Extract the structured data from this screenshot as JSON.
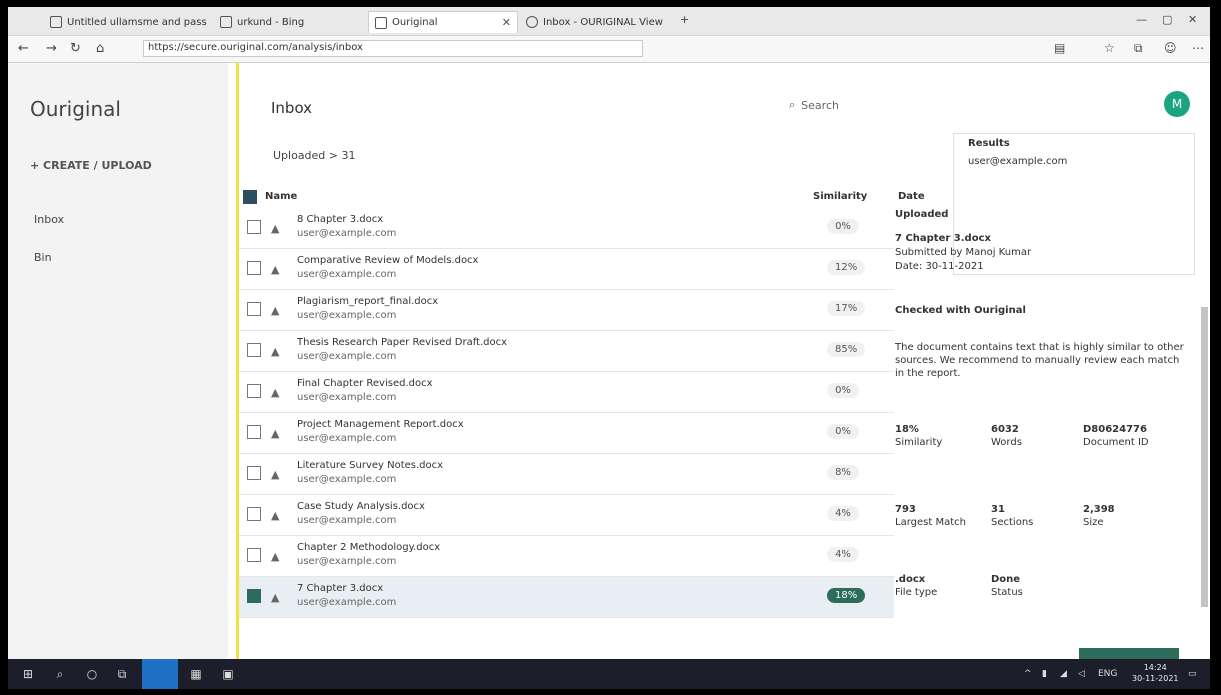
{
  "browser": {
    "tabs": [
      {
        "label": "Untitled ullamsme and pass"
      },
      {
        "label": "urkund - Bing"
      },
      {
        "label": "Ouriginal",
        "active": true
      },
      {
        "label": "Inbox - OURIGINAL View"
      }
    ],
    "new_tab": "+",
    "address": "https://secure.ouriginal.com/analysis/inbox",
    "window_controls": [
      "—",
      "▢",
      "✕"
    ]
  },
  "app": {
    "logo": "Ouriginal",
    "create_button": "+ CREATE / UPLOAD",
    "sidebar_links": [
      "Inbox",
      "Bin"
    ],
    "inbox_title": "Inbox",
    "folder": "Uploaded > 31",
    "search_placeholder": "Search",
    "avatar_letter": "M"
  },
  "list": {
    "header": {
      "name": "Name",
      "similarity": "Similarity",
      "date": "Date"
    },
    "rows": [
      {
        "file": "8 Chapter 3.docx",
        "email": "user@example.com",
        "pct": "0%"
      },
      {
        "file": "Comparative Review of Models.docx",
        "email": "user@example.com",
        "pct": "12%"
      },
      {
        "file": "Plagiarism_report_final.docx",
        "email": "user@example.com",
        "pct": "17%"
      },
      {
        "file": "Thesis Research Paper Revised Draft.docx",
        "email": "user@example.com",
        "pct": "85%"
      },
      {
        "file": "Final Chapter Revised.docx",
        "email": "user@example.com",
        "pct": "0%"
      },
      {
        "file": "Project Management Report.docx",
        "email": "user@example.com",
        "pct": "0%"
      },
      {
        "file": "Literature Survey Notes.docx",
        "email": "user@example.com",
        "pct": "8%"
      },
      {
        "file": "Case Study Analysis.docx",
        "email": "user@example.com",
        "pct": "4%"
      },
      {
        "file": "Chapter 2 Methodology.docx",
        "email": "user@example.com",
        "pct": "4%"
      },
      {
        "file": "7 Chapter 3.docx",
        "email": "user@example.com",
        "pct": "18%",
        "selected": true
      }
    ]
  },
  "detail": {
    "card_title": "Results",
    "card_email": "user@example.com",
    "uploaded_label": "Uploaded",
    "submitter": "7 Chapter 3.docx",
    "status_lines": [
      "Submitted by Manoj Kumar",
      "Date: 30-11-2021"
    ],
    "section_title": "Checked with Ouriginal",
    "note": "The document contains text that is highly similar to other sources. We recommend to manually review each match in the report.",
    "stats": [
      {
        "value": "18%",
        "label": "Similarity"
      },
      {
        "value": "6032",
        "label": "Words"
      },
      {
        "value": "D80624776",
        "label": "Document ID"
      },
      {
        "value": "793",
        "label": "Largest Match"
      },
      {
        "value": "31",
        "label": "Sections"
      },
      {
        "value": "2,398",
        "label": "Size"
      },
      {
        "value": ".docx",
        "label": "File type"
      },
      {
        "value": "Done",
        "label": "Status"
      }
    ]
  },
  "taskbar": {
    "lang": "ENG",
    "time": "14:24",
    "date": "30-11-2021"
  }
}
